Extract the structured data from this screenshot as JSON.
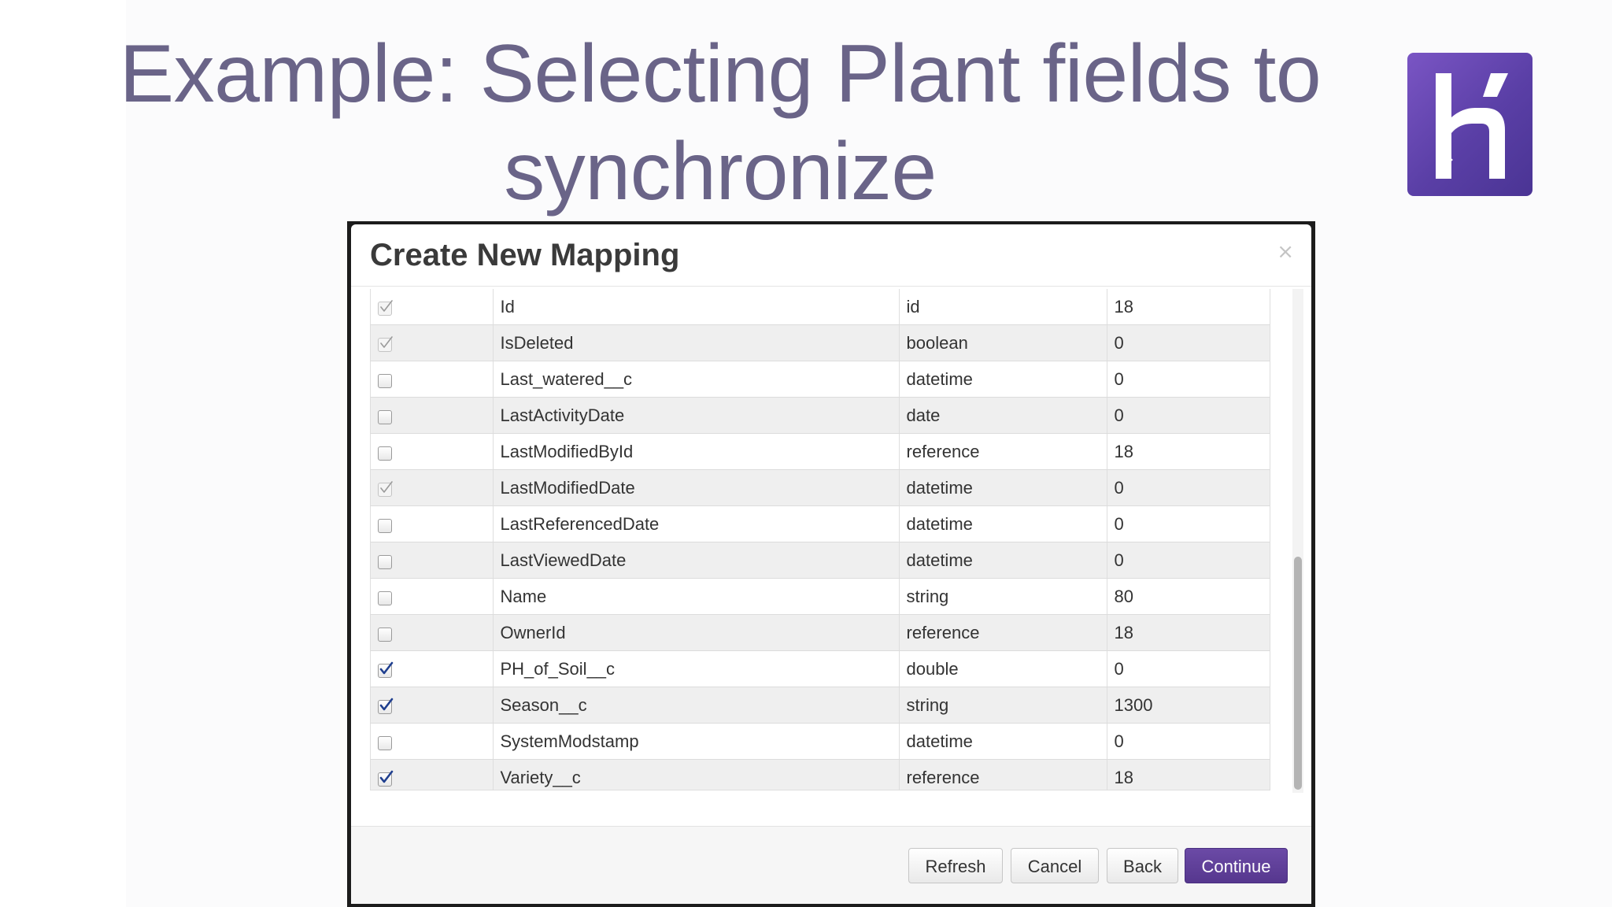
{
  "slide": {
    "title_line1": "Example: Selecting Plant fields to",
    "title_line2": "synchronize",
    "title_color": "#6a6488",
    "logo_icon": "heroku-logo-icon",
    "logo_color": "#6b4ab8"
  },
  "dialog": {
    "title": "Create New Mapping",
    "close_label": "×",
    "rows": [
      {
        "checked": true,
        "disabled": true,
        "name": "Id",
        "type": "id",
        "length": "18"
      },
      {
        "checked": true,
        "disabled": true,
        "name": "IsDeleted",
        "type": "boolean",
        "length": "0"
      },
      {
        "checked": false,
        "disabled": false,
        "name": "Last_watered__c",
        "type": "datetime",
        "length": "0"
      },
      {
        "checked": false,
        "disabled": false,
        "name": "LastActivityDate",
        "type": "date",
        "length": "0"
      },
      {
        "checked": false,
        "disabled": false,
        "name": "LastModifiedById",
        "type": "reference",
        "length": "18"
      },
      {
        "checked": true,
        "disabled": true,
        "name": "LastModifiedDate",
        "type": "datetime",
        "length": "0"
      },
      {
        "checked": false,
        "disabled": false,
        "name": "LastReferencedDate",
        "type": "datetime",
        "length": "0"
      },
      {
        "checked": false,
        "disabled": false,
        "name": "LastViewedDate",
        "type": "datetime",
        "length": "0"
      },
      {
        "checked": false,
        "disabled": false,
        "name": "Name",
        "type": "string",
        "length": "80"
      },
      {
        "checked": false,
        "disabled": false,
        "name": "OwnerId",
        "type": "reference",
        "length": "18"
      },
      {
        "checked": true,
        "disabled": false,
        "name": "PH_of_Soil__c",
        "type": "double",
        "length": "0"
      },
      {
        "checked": true,
        "disabled": false,
        "name": "Season__c",
        "type": "string",
        "length": "1300"
      },
      {
        "checked": false,
        "disabled": false,
        "name": "SystemModstamp",
        "type": "datetime",
        "length": "0"
      },
      {
        "checked": true,
        "disabled": false,
        "name": "Variety__c",
        "type": "reference",
        "length": "18"
      }
    ],
    "buttons": {
      "refresh": "Refresh",
      "cancel": "Cancel",
      "back": "Back",
      "continue": "Continue"
    },
    "colors": {
      "primary_button": "#5f3f9a",
      "checked_tick": "#1f3f8f",
      "disabled_tick": "#9a9a9a"
    }
  }
}
